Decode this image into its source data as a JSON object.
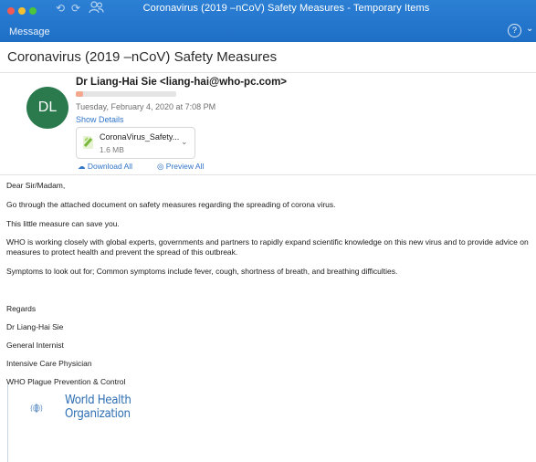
{
  "window": {
    "title": "Coronavirus (2019 –nCoV) Safety Measures - Temporary Items",
    "tab": "Message",
    "help_symbol": "?"
  },
  "email": {
    "subject": "Coronavirus (2019 –nCoV) Safety Measures",
    "avatar_initials": "DL",
    "sender": "Dr Liang-Hai Sie <liang-hai@who-pc.com>",
    "date": "Tuesday, February 4, 2020 at 7:08 PM",
    "show_details": "Show Details",
    "attachment": {
      "name": "CoronaVirus_Safety...",
      "size": "1.6 MB"
    },
    "download_all": "Download All",
    "preview_all": "Preview All"
  },
  "body": {
    "greeting": "Dear Sir/Madam,",
    "p1": "Go through the attached document on safety measures regarding the spreading of corona virus.",
    "p2": "This little measure can save you.",
    "p3": "WHO is working closely with global experts, governments and partners to rapidly expand scientific knowledge on this new virus and to provide advice on measures to protect health and prevent the spread of this outbreak.",
    "p4": "Symptoms to look out for; Common symptoms include fever, cough, shortness of breath, and breathing difficulties.",
    "regards": "Regards",
    "sig_name": "Dr Liang-Hai Sie",
    "sig_title1": "General Internist",
    "sig_title2": "Intensive Care Physician",
    "sig_org": "WHO Plague Prevention & Control"
  },
  "logo": {
    "line1": "World Health",
    "line2": "Organization"
  },
  "colors": {
    "titlebar": "#1e6ec6",
    "link": "#2f74c9",
    "avatar": "#2a7a4d",
    "who_blue": "#2f6fb3"
  },
  "icons": {
    "undo": "undo-icon",
    "redo": "redo-icon",
    "people": "people-icon",
    "help": "help-icon",
    "download": "cloud-download-icon",
    "preview": "eye-icon",
    "attachment": "file-icon"
  }
}
